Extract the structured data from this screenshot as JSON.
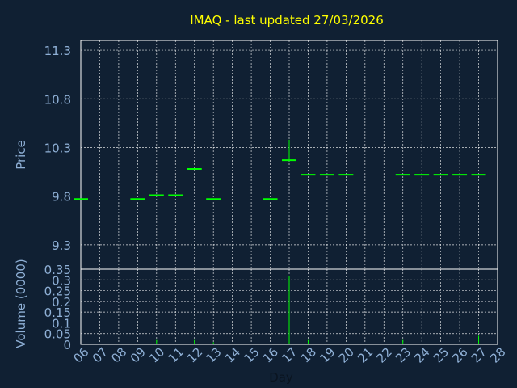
{
  "chart_data": [
    {
      "type": "ohlc",
      "title": "IMAQ - last updated 27/03/2026",
      "ylabel": "Price",
      "ylim": [
        9.05,
        11.4
      ],
      "yticks": [
        "11.3",
        "10.8",
        "10.3",
        "9.8",
        "9.3"
      ],
      "ytick_values": [
        11.3,
        10.8,
        10.3,
        9.8,
        9.3
      ],
      "x_days": [
        "06",
        "07",
        "08",
        "09",
        "10",
        "11",
        "12",
        "13",
        "14",
        "15",
        "16",
        "17",
        "18",
        "19",
        "20",
        "21",
        "22",
        "23",
        "24",
        "25",
        "26",
        "27",
        "28"
      ],
      "bars": [
        {
          "day": "06",
          "open": 9.77,
          "high": 9.77,
          "low": 9.77,
          "close": 9.77
        },
        {
          "day": "09",
          "open": 9.77,
          "high": 9.77,
          "low": 9.77,
          "close": 9.77
        },
        {
          "day": "10",
          "open": 9.81,
          "high": 9.81,
          "low": 9.81,
          "close": 9.81
        },
        {
          "day": "11",
          "open": 9.81,
          "high": 9.81,
          "low": 9.81,
          "close": 9.81
        },
        {
          "day": "12",
          "open": 10.08,
          "high": 10.08,
          "low": 10.08,
          "close": 10.08
        },
        {
          "day": "13",
          "open": 9.77,
          "high": 9.77,
          "low": 9.77,
          "close": 9.77
        },
        {
          "day": "16",
          "open": 9.77,
          "high": 9.77,
          "low": 9.77,
          "close": 9.77
        },
        {
          "day": "17",
          "open": 10.17,
          "high": 10.38,
          "low": 10.16,
          "close": 10.17
        },
        {
          "day": "18",
          "open": 10.02,
          "high": 10.02,
          "low": 10.02,
          "close": 10.02
        },
        {
          "day": "19",
          "open": 10.02,
          "high": 10.02,
          "low": 10.02,
          "close": 10.02
        },
        {
          "day": "20",
          "open": 10.02,
          "high": 10.02,
          "low": 10.02,
          "close": 10.02
        },
        {
          "day": "23",
          "open": 10.02,
          "high": 10.02,
          "low": 10.02,
          "close": 10.02
        },
        {
          "day": "24",
          "open": 10.02,
          "high": 10.02,
          "low": 10.02,
          "close": 10.02
        },
        {
          "day": "25",
          "open": 10.02,
          "high": 10.02,
          "low": 10.02,
          "close": 10.02
        },
        {
          "day": "26",
          "open": 10.02,
          "high": 10.02,
          "low": 10.02,
          "close": 10.02
        },
        {
          "day": "27",
          "open": 10.02,
          "high": 10.02,
          "low": 10.02,
          "close": 10.02
        }
      ],
      "color": "#00ff00",
      "grid": true
    },
    {
      "type": "bar",
      "ylabel": "Volume (0000)",
      "xlabel": "Day",
      "ylim": [
        0,
        0.35
      ],
      "yticks": [
        "0.35",
        "0.3",
        "0.25",
        "0.2",
        "0.15",
        "0.1",
        "0.05",
        "0"
      ],
      "ytick_values": [
        0.35,
        0.3,
        0.25,
        0.2,
        0.15,
        0.1,
        0.05,
        0
      ],
      "bars": [
        {
          "day": "10",
          "value": 0.02
        },
        {
          "day": "12",
          "value": 0.02
        },
        {
          "day": "13",
          "value": 0.01
        },
        {
          "day": "17",
          "value": 0.32
        },
        {
          "day": "18",
          "value": 0.02
        },
        {
          "day": "23",
          "value": 0.02
        },
        {
          "day": "27",
          "value": 0.04
        }
      ],
      "color": "#00ff00",
      "grid": true
    }
  ]
}
